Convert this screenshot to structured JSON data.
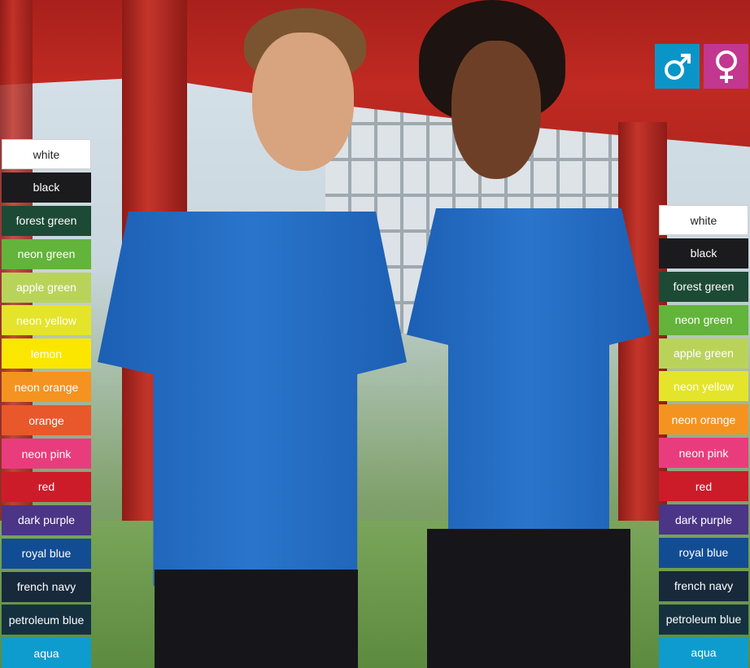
{
  "gender_icons": [
    {
      "icon": "male-icon",
      "color": "#0a95c8"
    },
    {
      "icon": "female-icon",
      "color": "#c2378f"
    }
  ],
  "left_swatches": [
    {
      "label": "white",
      "color": "#ffffff"
    },
    {
      "label": "black",
      "color": "#1b1b1d"
    },
    {
      "label": "forest green",
      "color": "#1d4a35"
    },
    {
      "label": "neon green",
      "color": "#63b43a"
    },
    {
      "label": "apple green",
      "color": "#b9d35a"
    },
    {
      "label": "neon yellow",
      "color": "#e4e42b"
    },
    {
      "label": "lemon",
      "color": "#fbe600"
    },
    {
      "label": "neon orange",
      "color": "#f59321"
    },
    {
      "label": "orange",
      "color": "#e8582a"
    },
    {
      "label": "neon pink",
      "color": "#e93c7d"
    },
    {
      "label": "red",
      "color": "#cc1c2a"
    },
    {
      "label": "dark purple",
      "color": "#4b3586"
    },
    {
      "label": "royal blue",
      "color": "#124d94"
    },
    {
      "label": "french navy",
      "color": "#18293c"
    },
    {
      "label": "petroleum blue",
      "color": "#15313f"
    },
    {
      "label": "aqua",
      "color": "#0e9ccf"
    }
  ],
  "right_swatches": [
    {
      "label": "white",
      "color": "#ffffff"
    },
    {
      "label": "black",
      "color": "#1b1b1d"
    },
    {
      "label": "forest green",
      "color": "#1d4a35"
    },
    {
      "label": "neon green",
      "color": "#63b43a"
    },
    {
      "label": "apple green",
      "color": "#b9d35a"
    },
    {
      "label": "neon yellow",
      "color": "#e4e42b"
    },
    {
      "label": "neon orange",
      "color": "#f59321"
    },
    {
      "label": "neon pink",
      "color": "#e93c7d"
    },
    {
      "label": "red",
      "color": "#cc1c2a"
    },
    {
      "label": "dark purple",
      "color": "#4b3586"
    },
    {
      "label": "royal blue",
      "color": "#124d94"
    },
    {
      "label": "french navy",
      "color": "#18293c"
    },
    {
      "label": "petroleum blue",
      "color": "#15313f"
    },
    {
      "label": "aqua",
      "color": "#0e9ccf"
    }
  ]
}
